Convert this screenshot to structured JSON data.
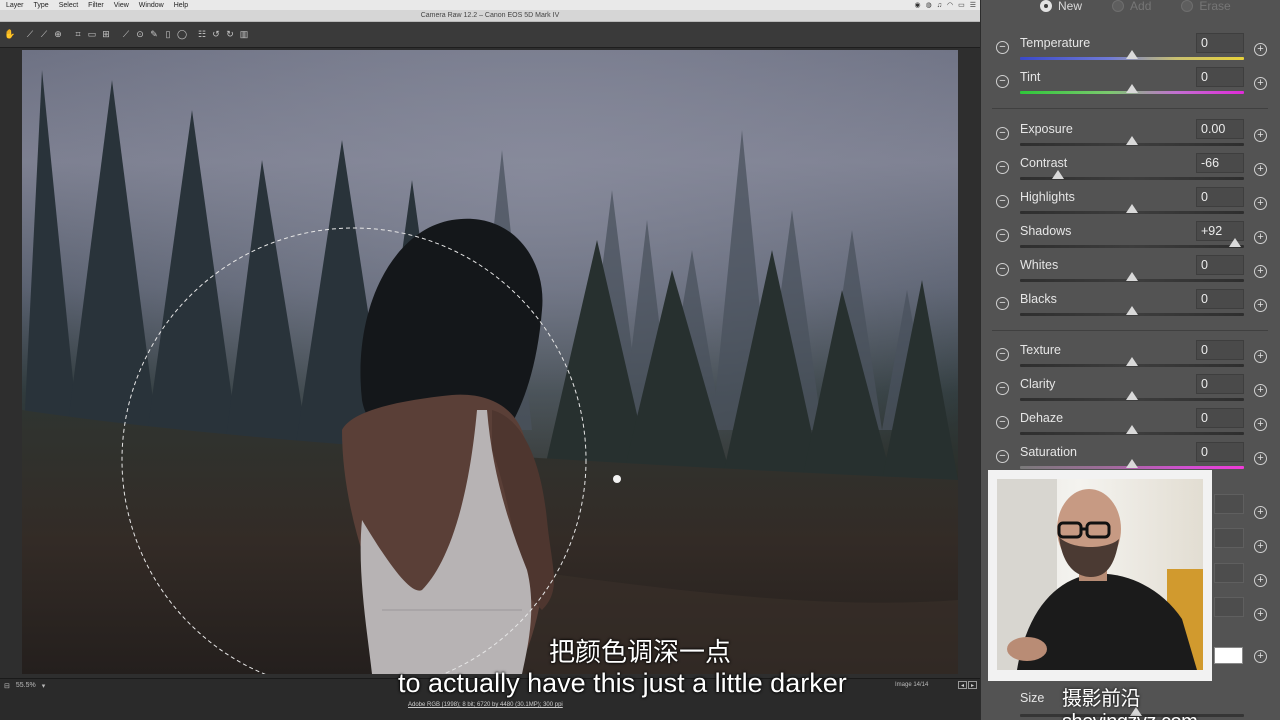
{
  "menubar": {
    "items": [
      "Layer",
      "Type",
      "Select",
      "Filter",
      "View",
      "Window",
      "Help"
    ]
  },
  "window": {
    "title": "Camera Raw 12.2  –  Canon EOS 5D Mark IV"
  },
  "status": {
    "zoom": "55.5%",
    "image_count": "Image 14/14",
    "workflow": "Adobe RGB (1998); 8 bit; 6720 by 4480 (30.1MP); 300 ppi"
  },
  "subtitles": {
    "cn": "把颜色调深一点",
    "en": "to actually have this just a little darker"
  },
  "panel": {
    "modes": [
      {
        "label": "New",
        "selected": true
      },
      {
        "label": "Add",
        "selected": false
      },
      {
        "label": "Erase",
        "selected": false
      }
    ],
    "sliders": [
      {
        "name": "temperature",
        "label": "Temperature",
        "value": "0",
        "position": 0.5,
        "track": "temp"
      },
      {
        "name": "tint",
        "label": "Tint",
        "value": "0",
        "position": 0.5,
        "track": "tint"
      },
      {
        "name": "exposure",
        "label": "Exposure",
        "value": "0.00",
        "position": 0.5,
        "track": "gray"
      },
      {
        "name": "contrast",
        "label": "Contrast",
        "value": "-66",
        "position": 0.17,
        "track": "gray"
      },
      {
        "name": "highlights",
        "label": "Highlights",
        "value": "0",
        "position": 0.5,
        "track": "gray"
      },
      {
        "name": "shadows",
        "label": "Shadows",
        "value": "+92",
        "position": 0.96,
        "track": "gray"
      },
      {
        "name": "whites",
        "label": "Whites",
        "value": "0",
        "position": 0.5,
        "track": "gray"
      },
      {
        "name": "blacks",
        "label": "Blacks",
        "value": "0",
        "position": 0.5,
        "track": "gray"
      },
      {
        "name": "texture",
        "label": "Texture",
        "value": "0",
        "position": 0.5,
        "track": "gray"
      },
      {
        "name": "clarity",
        "label": "Clarity",
        "value": "0",
        "position": 0.5,
        "track": "gray"
      },
      {
        "name": "dehaze",
        "label": "Dehaze",
        "value": "0",
        "position": 0.5,
        "track": "gray"
      },
      {
        "name": "saturation",
        "label": "Saturation",
        "value": "0",
        "position": 0.5,
        "track": "sat"
      }
    ],
    "size_label": "Size"
  },
  "watermark": "摄影前沿 sheyingzyz.com",
  "icons": {
    "toolbar": [
      "hand-icon",
      "white-balance-icon",
      "color-sampler-icon",
      "target-adjust-icon",
      "crop-icon",
      "straighten-icon",
      "transform-icon",
      "spot-removal-icon",
      "red-eye-icon",
      "adjustment-brush-icon",
      "graduated-filter-icon",
      "radial-filter-icon",
      "preferences-icon",
      "rotate-left-icon",
      "rotate-right-icon",
      "trash-icon"
    ]
  },
  "colors": {
    "panel_bg": "#535353",
    "canvas_bg": "#2e2e2e",
    "accent": "#d9d9d9"
  }
}
